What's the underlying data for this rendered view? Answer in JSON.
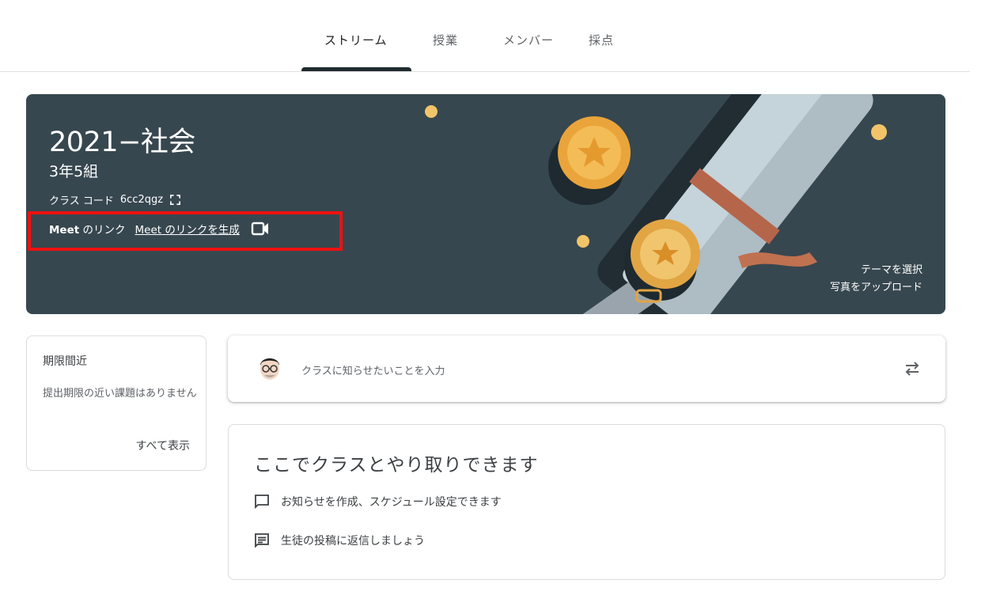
{
  "tabs": [
    {
      "label": "ストリーム",
      "active": true
    },
    {
      "label": "授業",
      "active": false
    },
    {
      "label": "メンバー",
      "active": false
    },
    {
      "label": "採点",
      "active": false
    }
  ],
  "banner": {
    "title": "2021−社会",
    "section": "3年5組",
    "class_code_label": "クラス コード",
    "class_code": "6cc2qgz",
    "meet_label_bold": "Meet",
    "meet_label_rest": " のリンク",
    "meet_link": "Meet のリンクを生成",
    "select_theme": "テーマを選択",
    "upload_photo": "写真をアップロード",
    "background_color": "#37474f"
  },
  "upcoming": {
    "title": "期限間近",
    "text": "提出期限の近い課題はありません",
    "view_all": "すべて表示"
  },
  "announce": {
    "placeholder": "クラスに知らせたいことを入力"
  },
  "info": {
    "title": "ここでクラスとやり取りできます",
    "items": [
      {
        "icon": "comment-icon",
        "text": "お知らせを作成、スケジュール設定できます"
      },
      {
        "icon": "chat-reply-icon",
        "text": "生徒の投稿に返信しましょう"
      }
    ]
  },
  "highlight_color": "#ee1111"
}
